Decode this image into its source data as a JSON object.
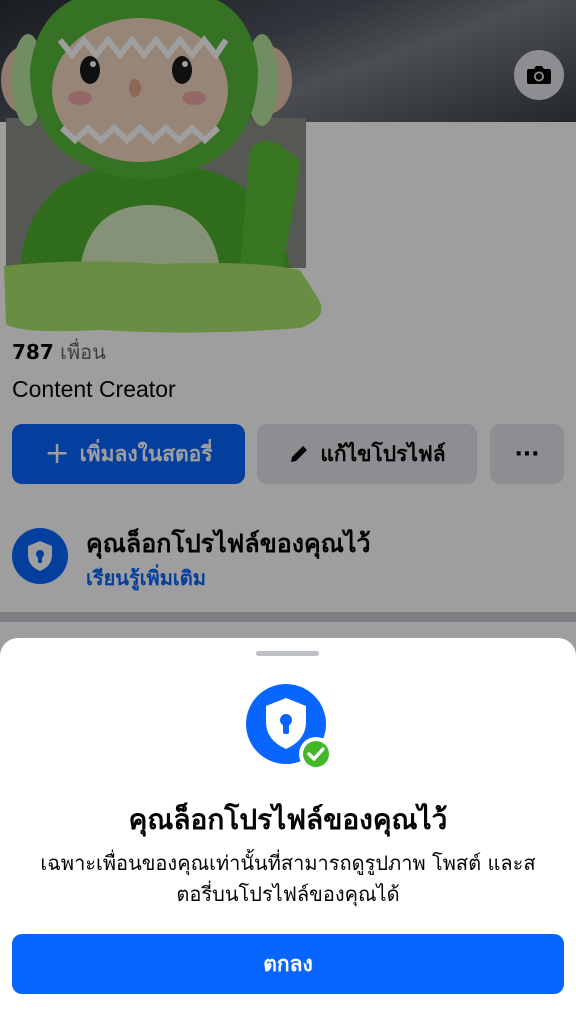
{
  "profile": {
    "friends_count": "787",
    "friends_label": "เพื่อน",
    "bio": "Content Creator",
    "add_story_label": "เพิ่มลงในสตอรี่",
    "edit_profile_label": "แก้ไขโปรไฟล์",
    "more_label": "···",
    "lock_title": "คุณล็อกโปรไฟล์ของคุณไว้",
    "lock_link": "เรียนรู้เพิ่มเติม"
  },
  "sheet": {
    "title": "คุณล็อกโปรไฟล์ของคุณไว้",
    "description": "เฉพาะเพื่อนของคุณเท่านั้นที่สามารถดูรูปภาพ โพสต์ และสตอรี่บนโปรไฟล์ของคุณได้",
    "ok_label": "ตกลง"
  },
  "icons": {
    "cover_camera": "camera-icon",
    "add": "plus-icon",
    "edit": "pencil-icon",
    "lock": "shield-lock-icon",
    "check": "check-badge-icon"
  },
  "colors": {
    "accent": "#0866ff",
    "secondary_button": "#e4e6eb",
    "success": "#42b72a",
    "redaction": "#a8e46c"
  }
}
